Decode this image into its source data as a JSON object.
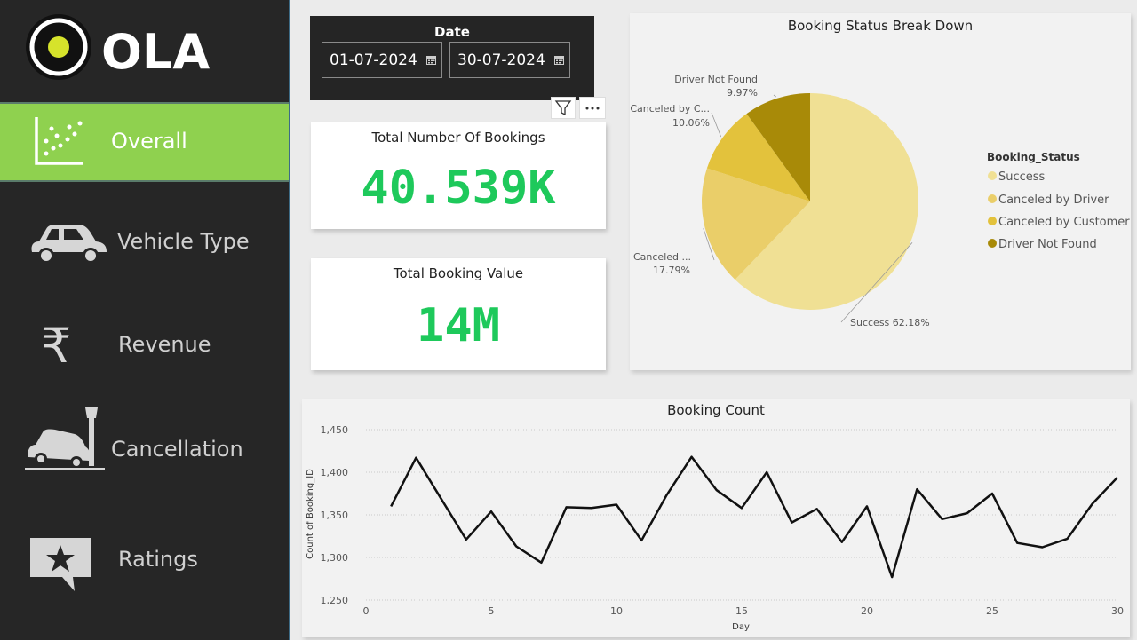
{
  "brand": {
    "name": "OLA"
  },
  "nav": {
    "items": [
      {
        "label": "Overall",
        "icon": "scatter-chart-icon",
        "active": true
      },
      {
        "label": "Vehicle Type",
        "icon": "car-icon"
      },
      {
        "label": "Revenue",
        "icon": "rupee-icon"
      },
      {
        "label": "Cancellation",
        "icon": "car-crash-icon"
      },
      {
        "label": "Ratings",
        "icon": "star-comment-icon"
      }
    ]
  },
  "date_slicer": {
    "title": "Date",
    "start": "01-07-2024",
    "end": "30-07-2024"
  },
  "kpis": {
    "bookings": {
      "title": "Total Number Of Bookings",
      "value": "40.539K"
    },
    "value": {
      "title": "Total Booking Value",
      "value": "14M"
    }
  },
  "colors": {
    "accent_green": "#8fd14f",
    "kpi_green": "#1ec95b"
  },
  "pie": {
    "chart_data": {
      "type": "pie",
      "title": "Booking Status Break Down",
      "legend_title": "Booking_Status",
      "slices": [
        {
          "name": "Success",
          "value": 62.18,
          "color": "#f0e094",
          "label": "Success 62.18%"
        },
        {
          "name": "Canceled by Driver",
          "value": 17.79,
          "color": "#eace69",
          "label_line1": "Canceled ...",
          "label_line2": "17.79%"
        },
        {
          "name": "Canceled by Customer",
          "value": 10.06,
          "color": "#e3c23c",
          "label_line1": "Canceled by C...",
          "label_line2": "10.06%"
        },
        {
          "name": "Driver Not Found",
          "value": 9.97,
          "color": "#a88a08",
          "label_line1": "Driver Not Found",
          "label_line2": "9.97%"
        }
      ],
      "legend_placement": "right"
    }
  },
  "chart_data": {
    "type": "line",
    "title": "Booking Count",
    "xlabel": "Day",
    "ylabel": "Count of Booking_ID",
    "x": [
      1,
      2,
      3,
      4,
      5,
      6,
      7,
      8,
      9,
      10,
      11,
      12,
      13,
      14,
      15,
      16,
      17,
      18,
      19,
      20,
      21,
      22,
      23,
      24,
      25,
      26,
      27,
      28,
      29,
      30
    ],
    "series": [
      {
        "values": [
          1360,
          1417,
          1369,
          1321,
          1354,
          1313,
          1294,
          1359,
          1358,
          1362,
          1320,
          1373,
          1418,
          1379,
          1358,
          1400,
          1341,
          1357,
          1318,
          1360,
          1277,
          1380,
          1345,
          1352,
          1375,
          1317,
          1312,
          1322,
          1363,
          1394
        ]
      }
    ],
    "xlim": [
      0,
      30
    ],
    "ylim": [
      1250,
      1450
    ],
    "xticks": [
      "0",
      "5",
      "10",
      "15",
      "20",
      "25",
      "30"
    ],
    "yticks": [
      "1,250",
      "1,300",
      "1,350",
      "1,400",
      "1,450"
    ],
    "xtick_values": [
      0,
      5,
      10,
      15,
      20,
      25,
      30
    ],
    "ytick_values": [
      1250,
      1300,
      1350,
      1400,
      1450
    ],
    "grid": true
  }
}
